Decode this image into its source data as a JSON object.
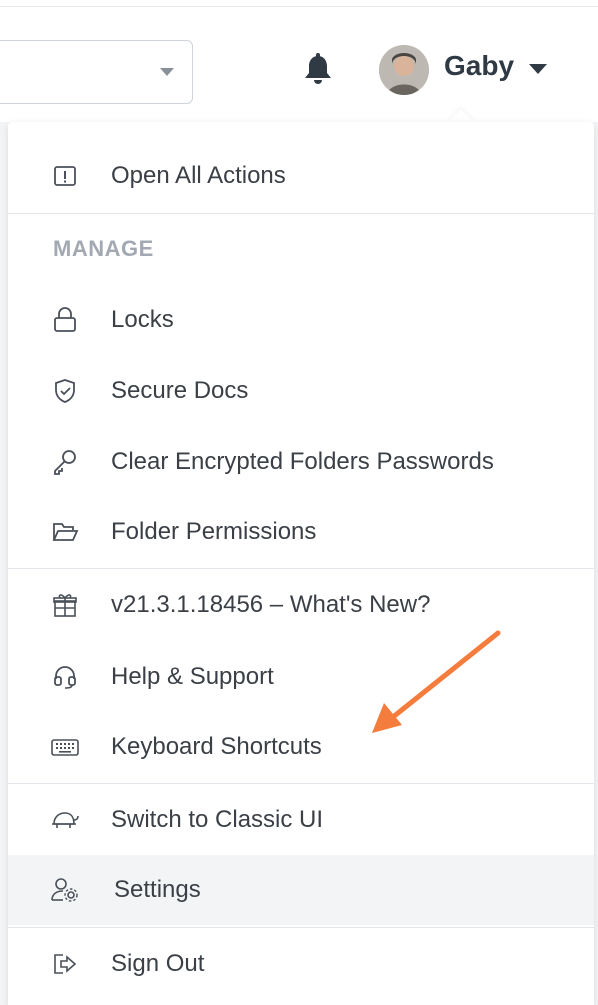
{
  "header": {
    "user_name": "Gaby"
  },
  "menu": {
    "open_all_actions": "Open All Actions",
    "manage_title": "MANAGE",
    "locks": "Locks",
    "secure_docs": "Secure Docs",
    "clear_encrypted": "Clear Encrypted Folders Passwords",
    "folder_permissions": "Folder Permissions",
    "whats_new": "v21.3.1.18456 – What's New?",
    "help_support": "Help & Support",
    "keyboard_shortcuts": "Keyboard Shortcuts",
    "switch_classic": "Switch to Classic UI",
    "settings": "Settings",
    "sign_out": "Sign Out"
  },
  "colors": {
    "annotation_arrow": "#f47c3c",
    "active_row": "#f3f4f6"
  },
  "icons": [
    "exclamation-square-icon",
    "lock-icon",
    "shield-check-icon",
    "key-icon",
    "folder-open-icon",
    "gift-icon",
    "headset-icon",
    "keyboard-icon",
    "turtle-icon",
    "user-gear-icon",
    "sign-out-icon",
    "bell-icon",
    "chevron-down-icon"
  ]
}
